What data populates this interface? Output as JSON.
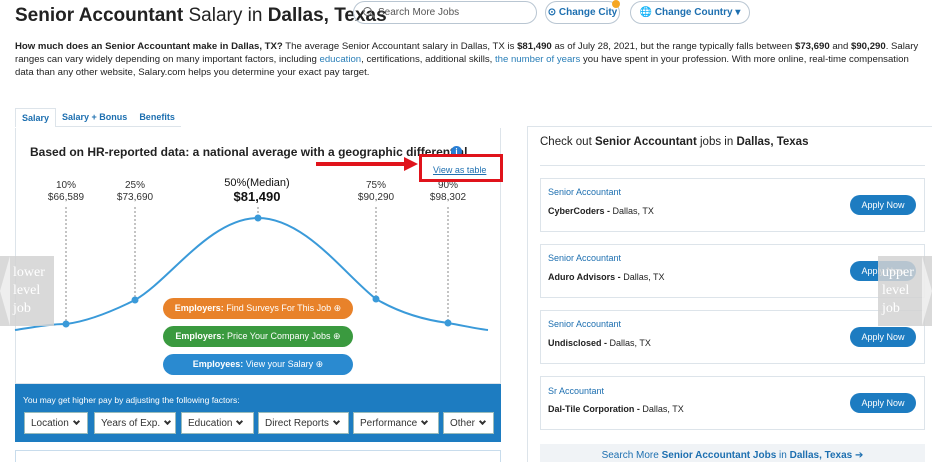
{
  "header": {
    "title_job": "Senior Accountant",
    "title_mid": " Salary in ",
    "title_city": "Dallas, Texas",
    "search_placeholder": "Search More Jobs",
    "change_city": "Change City",
    "change_country": "Change Country"
  },
  "intro": {
    "q": "How much does an Senior Accountant make in Dallas, TX?",
    "t1": " The average Senior Accountant salary in Dallas, TX is ",
    "avg": "$81,490",
    "t2": " as of July 28, 2021, but the range typically falls between ",
    "low": "$73,690",
    "t3": " and ",
    "high": "$90,290",
    "t4": ". Salary ranges can vary widely depending on many important factors, including ",
    "link1": "education",
    "t5": ", certifications, additional skills, ",
    "link2": "the number of years",
    "t6": " you have spent in your profession. With more online, real-time compensation data than any other website, Salary.com helps you determine your exact pay target."
  },
  "tabs": [
    "Salary",
    "Salary + Bonus",
    "Benefits"
  ],
  "chart": {
    "headline": "Based on HR-reported data: a national average with a geographic differential",
    "view_as_table": "View as table",
    "percentiles": [
      {
        "label": "10%",
        "value": "$66,589"
      },
      {
        "label": "25%",
        "value": "$73,690"
      },
      {
        "label": "50%(Median)",
        "value": "$81,490"
      },
      {
        "label": "75%",
        "value": "$90,290"
      },
      {
        "label": "90%",
        "value": "$98,302"
      }
    ]
  },
  "cta": [
    {
      "bold": "Employers:",
      "text": " Find Surveys For This Job",
      "color": "#e8822a"
    },
    {
      "bold": "Employers:",
      "text": " Price Your Company Jobs",
      "color": "#3a9a3f"
    },
    {
      "bold": "Employees:",
      "text": " View your Salary",
      "color": "#2a8ad0"
    }
  ],
  "factors": {
    "label": "You may get higher pay by adjusting the following factors:",
    "options": [
      "Location",
      "Years of Exp.",
      "Education",
      "Direct Reports",
      "Performance",
      "Other"
    ]
  },
  "jobs": {
    "title_pre": "Check out ",
    "title_job": "Senior Accountant",
    "title_mid": " jobs in ",
    "title_city": "Dallas, Texas",
    "items": [
      {
        "title": "Senior Accountant",
        "company": "CyberCoders -",
        "location": " Dallas, TX",
        "apply": "Apply Now"
      },
      {
        "title": "Senior Accountant",
        "company": "Aduro Advisors -",
        "location": " Dallas, TX",
        "apply": "Apply Now"
      },
      {
        "title": "Senior Accountant",
        "company": "Undisclosed -",
        "location": " Dallas, TX",
        "apply": "Apply Now"
      },
      {
        "title": "Sr Accountant",
        "company": "Dal-Tile Corporation -",
        "location": " Dallas, TX",
        "apply": "Apply Now"
      }
    ],
    "search_more_pre": "Search More ",
    "search_more_job": "Senior Accountant Jobs",
    "search_more_mid": " in ",
    "search_more_city": "Dallas, Texas"
  },
  "nav": {
    "lower": "lower\nlevel\njob",
    "upper": "upper\nlevel\njob"
  },
  "colors": {
    "accent": "#1d7cc1",
    "link": "#1d6fb0",
    "highlight": "#e0131b",
    "curve": "#3a9ad9"
  }
}
